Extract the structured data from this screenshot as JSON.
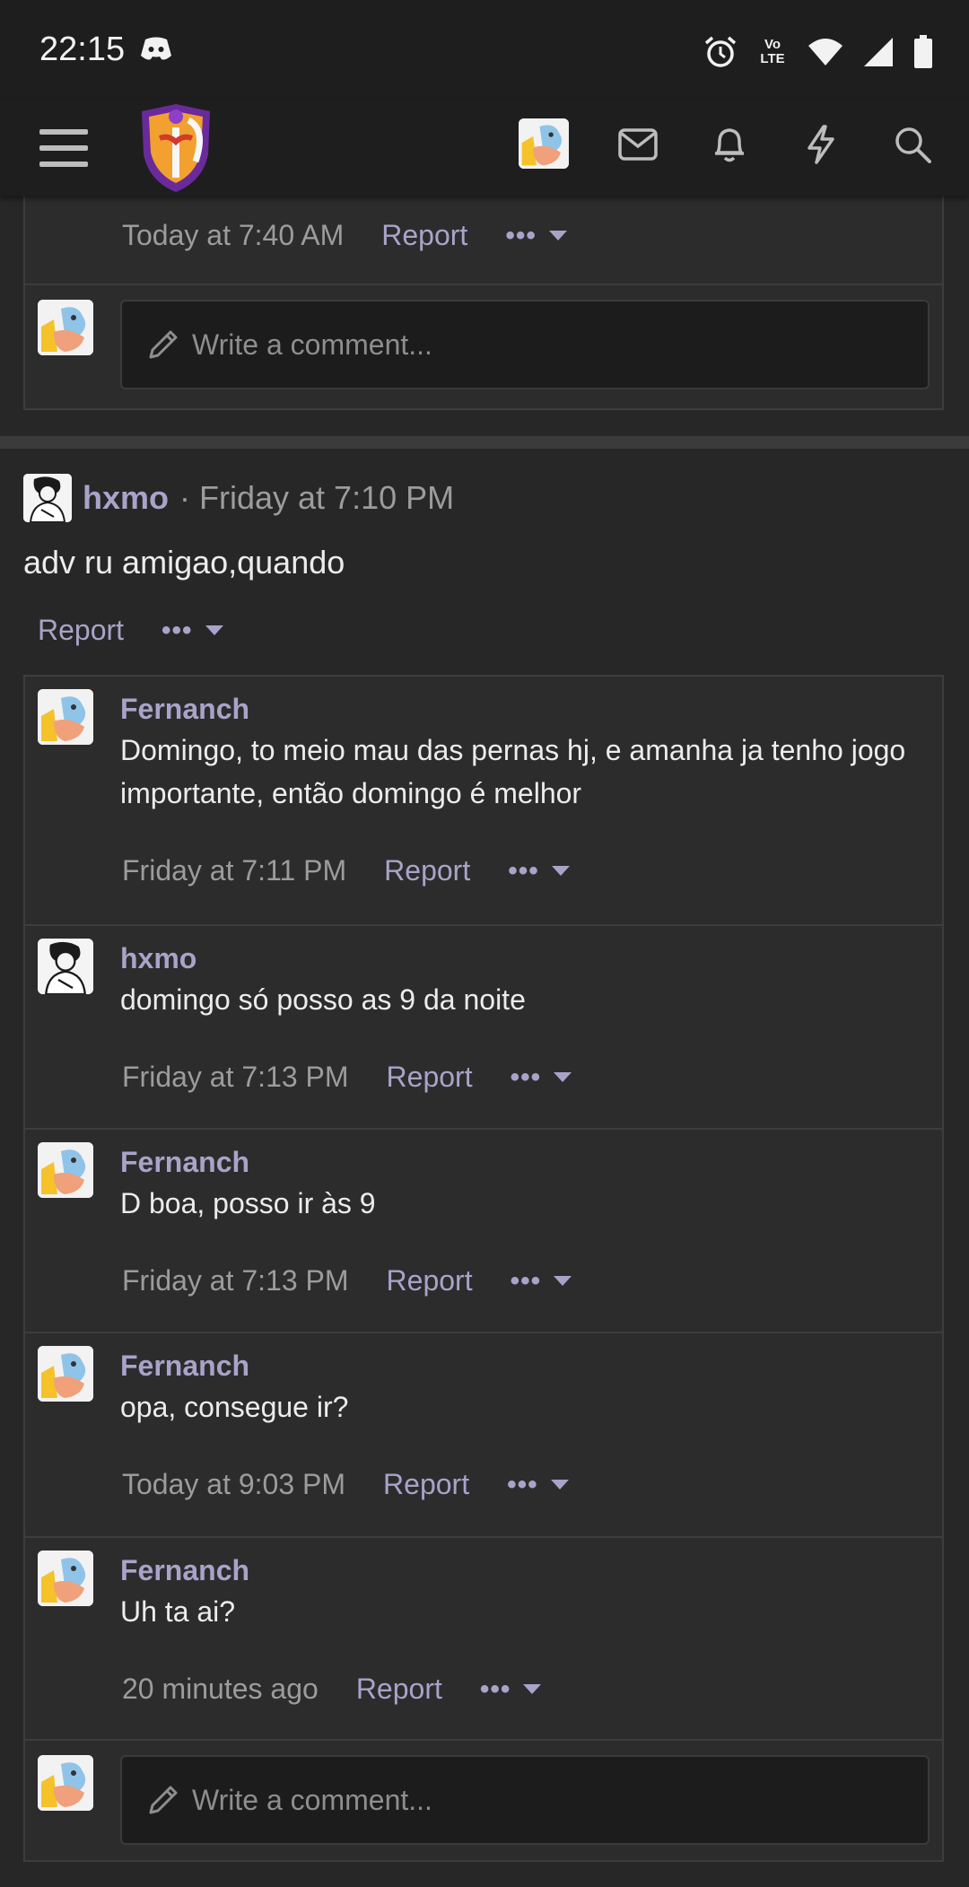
{
  "status_bar": {
    "time": "22:15",
    "icons": [
      "discord-icon",
      "alarm-icon",
      "volte-icon",
      "wifi-icon",
      "signal-icon",
      "battery-icon"
    ],
    "volte_text": "Vo LTE"
  },
  "app_bar": {
    "icons": [
      "menu-icon",
      "site-logo",
      "user-avatar",
      "mail-icon",
      "bell-icon",
      "bolt-icon",
      "search-icon"
    ]
  },
  "top_thread": {
    "last_meta": {
      "time": "Today at 7:40 AM",
      "report": "Report",
      "more": "•••"
    },
    "write_placeholder": "Write a comment..."
  },
  "post": {
    "author": "hxmo",
    "date": "· Friday at 7:10 PM",
    "text": "adv ru amigao,quando",
    "report": "Report",
    "more": "•••",
    "comments": [
      {
        "author": "Fernanch",
        "text": "Domingo, to meio mau das pernas hj, e amanha ja tenho jogo importante, então domingo é melhor",
        "time": "Friday at 7:11 PM",
        "report": "Report",
        "more": "•••"
      },
      {
        "author": "hxmo",
        "text": "domingo só posso as 9 da noite",
        "time": "Friday at 7:13 PM",
        "report": "Report",
        "more": "•••"
      },
      {
        "author": "Fernanch",
        "text": "D boa, posso ir às 9",
        "time": "Friday at 7:13 PM",
        "report": "Report",
        "more": "•••"
      },
      {
        "author": "Fernanch",
        "text": "opa, consegue ir?",
        "time": "Today at 9:03 PM",
        "report": "Report",
        "more": "•••"
      },
      {
        "author": "Fernanch",
        "text": "Uh ta ai?",
        "time": "20 minutes ago",
        "report": "Report",
        "more": "•••"
      }
    ],
    "write_placeholder": "Write a comment..."
  },
  "colors": {
    "background": "#272727",
    "bar": "#1e1e1e",
    "accent_username": "#a9a3c9",
    "muted": "#9c9c9c"
  }
}
